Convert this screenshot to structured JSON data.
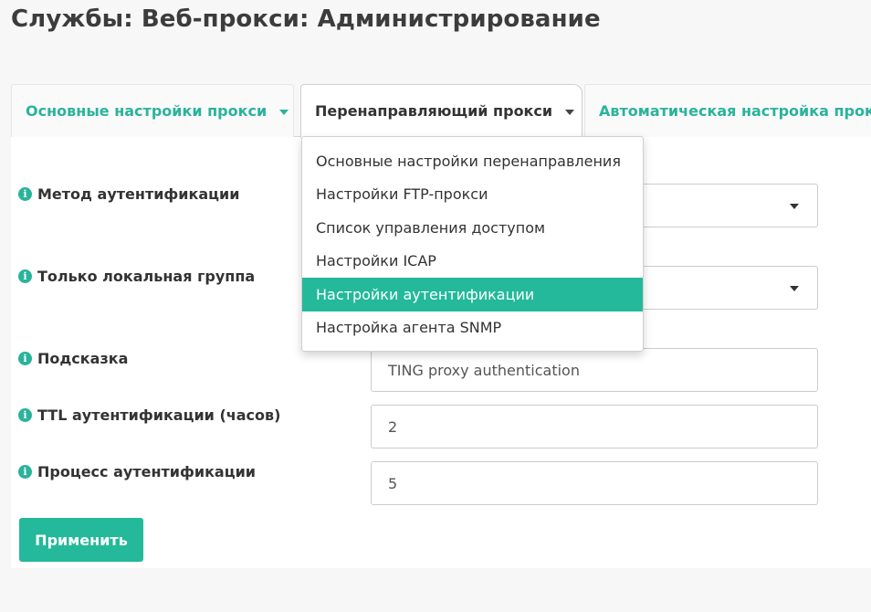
{
  "page": {
    "title": "Службы: Веб-прокси: Администрирование"
  },
  "tabs": [
    {
      "label": "Основные настройки прокси",
      "active": false
    },
    {
      "label": "Перенаправляющий прокси",
      "active": true
    },
    {
      "label": "Автоматическая настройка прокси",
      "active": false
    }
  ],
  "dropdown": {
    "items": [
      {
        "label": "Основные настройки перенаправления"
      },
      {
        "label": "Настройки FTP-прокси"
      },
      {
        "label": "Список управления доступом"
      },
      {
        "label": "Настройки ICAP"
      },
      {
        "label": "Настройки аутентификации",
        "active": true
      },
      {
        "label": "Настройка агента SNMP"
      }
    ]
  },
  "form": {
    "auth_method": {
      "label": "Метод аутентификации",
      "value": ""
    },
    "local_group": {
      "label": "Только локальная группа",
      "value": ""
    },
    "prompt": {
      "label": "Подсказка",
      "value": "TING proxy authentication"
    },
    "auth_ttl": {
      "label": "TTL аутентификации (часов)",
      "value": "2"
    },
    "auth_processes": {
      "label": "Процесс аутентификации",
      "value": "5"
    }
  },
  "buttons": {
    "apply_label": "Применить"
  },
  "icons": {
    "info": "info-icon",
    "caret": "caret-down-icon"
  },
  "colors": {
    "accent": "#23b99a",
    "tab_text": "#2ab39b",
    "text": "#333333"
  }
}
